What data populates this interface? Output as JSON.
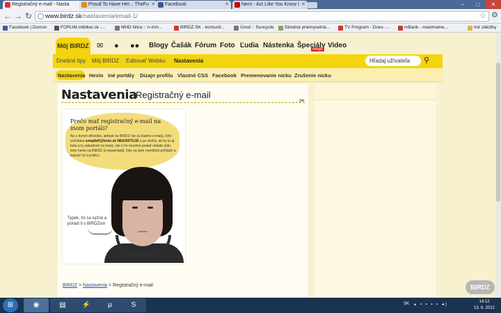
{
  "browser": {
    "tabs": [
      {
        "title": "Registračný e-mail - Nasta",
        "active": true,
        "icon_color": "#d9332a"
      },
      {
        "title": "Proud To Have Her... TheFu",
        "active": false,
        "icon_color": "#e38b22"
      },
      {
        "title": "Facebook",
        "active": false,
        "icon_color": "#3b5998"
      },
      {
        "title": "Nero - Act Like You Know I",
        "active": false,
        "icon_color": "#d10000"
      }
    ],
    "url_host": "www.birdz.sk",
    "url_path": "/nastavenia/email-1/",
    "bookmarks": [
      {
        "label": "Facebook | Domov",
        "icon_color": "#3b5998"
      },
      {
        "label": "FORUM.mtbiker.sk -...",
        "icon_color": "#555555"
      },
      {
        "label": "MHD Nitra :: n-imh...",
        "icon_color": "#777777"
      },
      {
        "label": "BIRDZ.SK - komunit...",
        "icon_color": "#d9332a"
      },
      {
        "label": "Úvod :: Suncycle",
        "icon_color": "#777777"
      },
      {
        "label": "Stredná priemyselná...",
        "icon_color": "#8aa35c"
      },
      {
        "label": "TV Program - Dnes -...",
        "icon_color": "#d9332a"
      },
      {
        "label": "mBank - maximalne...",
        "icon_color": "#c0392b"
      },
      {
        "label": "Iné záložky",
        "icon_color": "#e0b44a"
      }
    ]
  },
  "site": {
    "brand_tab": "Môj BIRDZ",
    "main_nav": [
      "Blogy",
      "Čašák",
      "Fórum",
      "Foto",
      "Ľudia",
      "Nástenka",
      "Špeciály",
      "Video"
    ],
    "badge": "nefajčí",
    "sub_nav": [
      "Dnešné tipy",
      "Môj BIRDZ",
      "Editovať Webku",
      "Nastavenia"
    ],
    "search_placeholder": "Hľadaj užívateľa",
    "settings_nav": [
      "Nastavenia",
      "Heslo",
      "Iné portály",
      "Dizajn profilu",
      "Vlastné CSS",
      "Facebook",
      "Premenovanie nicku",
      "Zrušenie nicku"
    ]
  },
  "content": {
    "title": "Nastavenia",
    "subtitle": "Registračný e-mail",
    "question": "Prečo mať registračný e-mail na inom portáli?",
    "body_pre": "No z dvoch dôvodov, jednak na BIRDZ nie sú žiadne e-maily, čiže schránka ",
    "email": "smajdaff@birdz.sk",
    "body_bold": "NEEXISTUJE",
    "body_post": " a po druhé, ak by tu aj bola a ty zabudneš na heslo, tak ti ho musíme poslať niekde inde, lebo heslo na BIRDZ si nepamätáš, čiže sa sem nemôžeš prihlásiť a kuknúť čo ti prišlo:)",
    "tip": "Typek, čo sa vyzná a poradí ti s BIRDZom",
    "breadcrumb": [
      "BIRDZ",
      "Nastavenia",
      "Registračný e-mail"
    ]
  },
  "watermark": "BIRDZ",
  "taskbar": {
    "lang": "SK",
    "time": "14:12",
    "date": "13. 6. 2012"
  }
}
